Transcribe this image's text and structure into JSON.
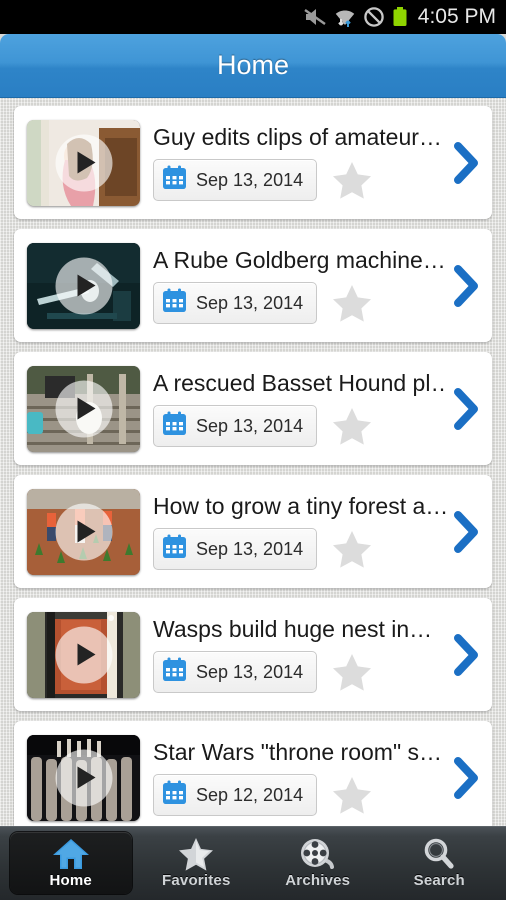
{
  "status_bar": {
    "icons": [
      "mute-icon",
      "wifi-icon",
      "do-not-disturb-icon",
      "battery-icon"
    ],
    "time": "4:05 PM",
    "battery_color": "#8fd400"
  },
  "header": {
    "title": "Home",
    "accent_color": "#3f95d5"
  },
  "list": {
    "items": [
      {
        "title": "Guy edits clips of amateur…",
        "date": "Sep 13, 2014",
        "play_label": "play-icon",
        "favorite": false
      },
      {
        "title": "A Rube Goldberg machine…",
        "date": "Sep 13, 2014",
        "play_label": "play-icon",
        "favorite": false
      },
      {
        "title": "A rescued Basset Hound pl…",
        "date": "Sep 13, 2014",
        "play_label": "play-icon",
        "favorite": false
      },
      {
        "title": "How to grow a tiny forest a…",
        "date": "Sep 13, 2014",
        "play_label": "play-icon",
        "favorite": false
      },
      {
        "title": "Wasps build huge nest in…",
        "date": "Sep 13, 2014",
        "play_label": "play-icon",
        "favorite": false
      },
      {
        "title": "Star Wars \"throne room\" s…",
        "date": "Sep 12, 2014",
        "play_label": "play-icon",
        "favorite": false
      }
    ]
  },
  "tabbar": {
    "active_index": 0,
    "tabs": [
      {
        "label": "Home",
        "icon": "home-icon"
      },
      {
        "label": "Favorites",
        "icon": "star-icon"
      },
      {
        "label": "Archives",
        "icon": "film-reel-icon"
      },
      {
        "label": "Search",
        "icon": "magnifier-icon"
      }
    ]
  }
}
